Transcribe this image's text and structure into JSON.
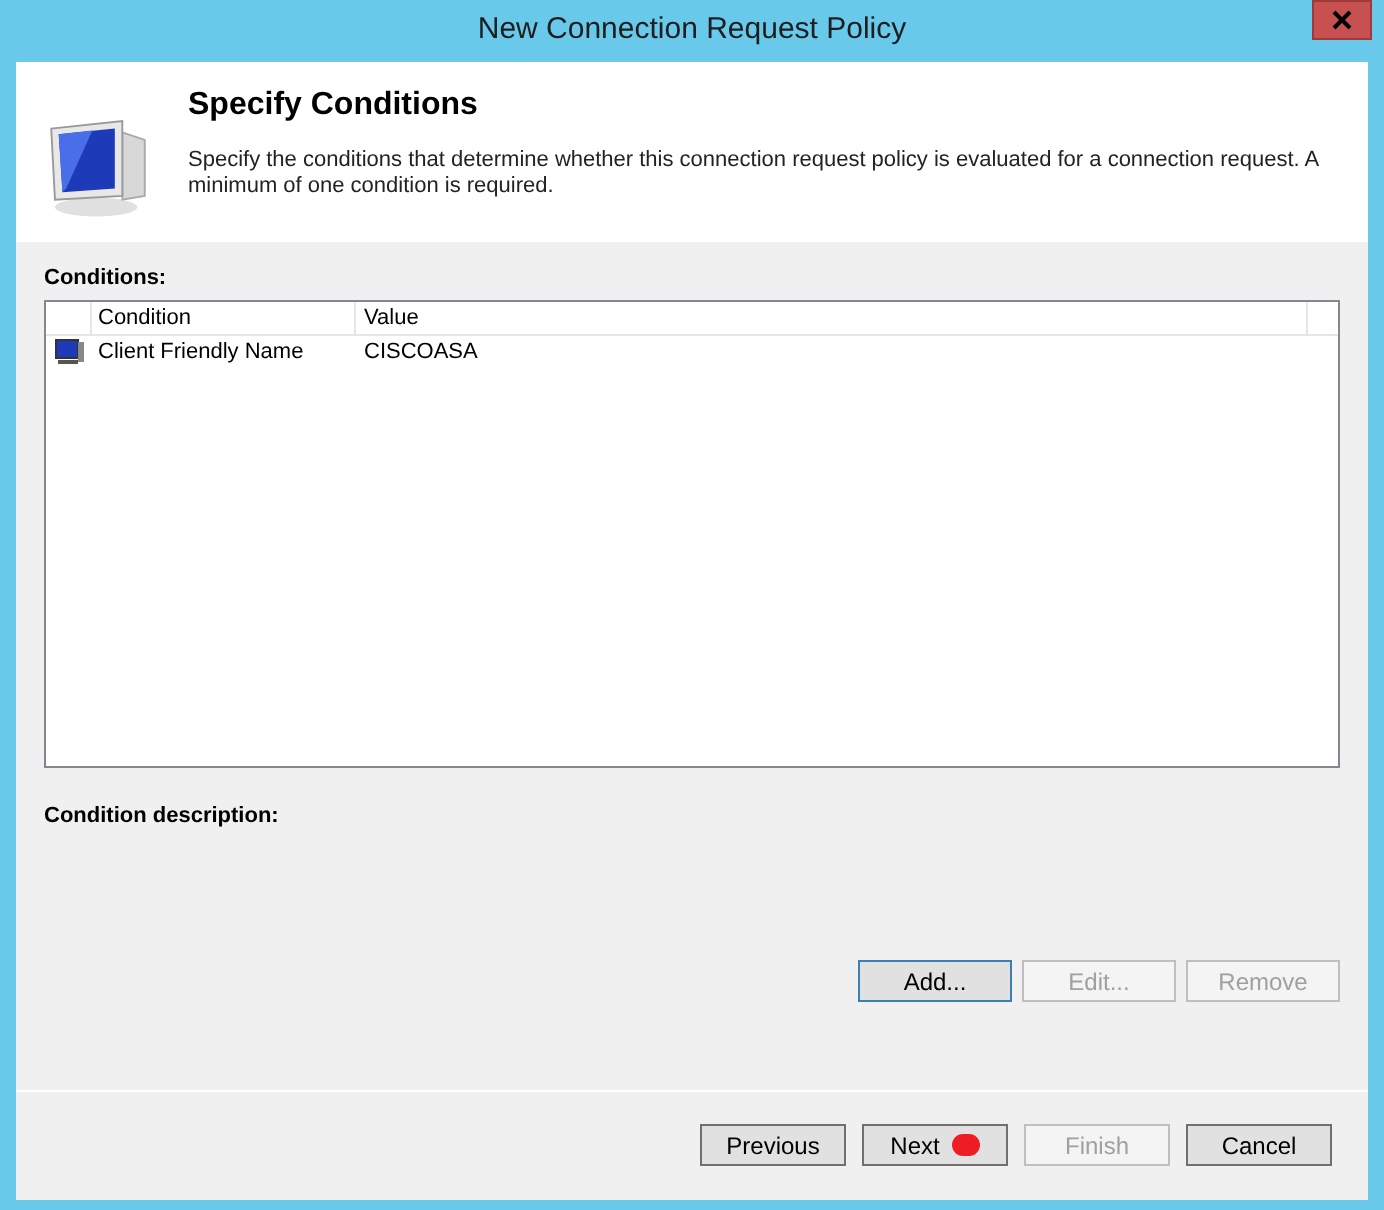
{
  "window": {
    "title": "New Connection Request Policy"
  },
  "header": {
    "title": "Specify Conditions",
    "description": "Specify the conditions that determine whether this connection request policy is evaluated for a connection request. A minimum of one condition is required."
  },
  "conditions": {
    "label": "Conditions:",
    "columns": [
      "Condition",
      "Value"
    ],
    "rows": [
      {
        "condition": "Client Friendly Name",
        "value": "CISCOASA",
        "selected": false
      }
    ]
  },
  "condition_description": {
    "label": "Condition description:"
  },
  "condition_buttons": [
    {
      "label": "Add...",
      "disabled": false,
      "focused": true
    },
    {
      "label": "Edit...",
      "disabled": true,
      "focused": false
    },
    {
      "label": "Remove",
      "disabled": true,
      "focused": false
    }
  ],
  "footer_buttons": [
    {
      "label": "Previous",
      "disabled": false,
      "marked": false
    },
    {
      "label": "Next",
      "disabled": false,
      "marked": true
    },
    {
      "label": "Finish",
      "disabled": true,
      "marked": false
    },
    {
      "label": "Cancel",
      "disabled": false,
      "marked": false
    }
  ]
}
